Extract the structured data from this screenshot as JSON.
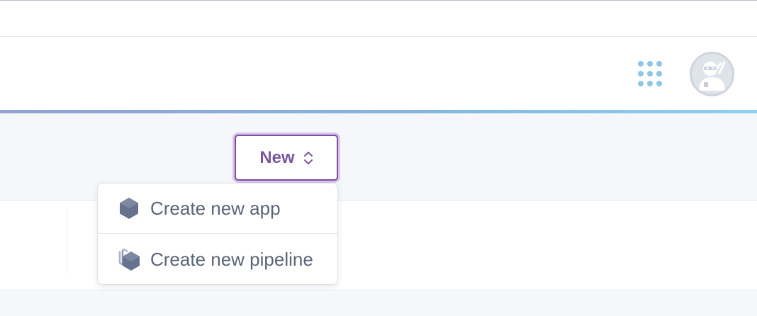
{
  "header": {
    "apps_icon": "apps-grid-icon",
    "avatar_icon": "ninja-avatar-icon"
  },
  "toolbar": {
    "new_button_label": "New",
    "new_button_icon": "chevron-up-down-icon"
  },
  "dropdown": {
    "items": [
      {
        "label": "Create new app",
        "icon": "hexagon-icon"
      },
      {
        "label": "Create new pipeline",
        "icon": "stacked-hexagons-icon"
      }
    ]
  },
  "colors": {
    "accent_purple": "#79589f",
    "apps_dots": "#8fc6e8",
    "icon_slate": "#66738f",
    "menu_text": "#5a6478"
  }
}
